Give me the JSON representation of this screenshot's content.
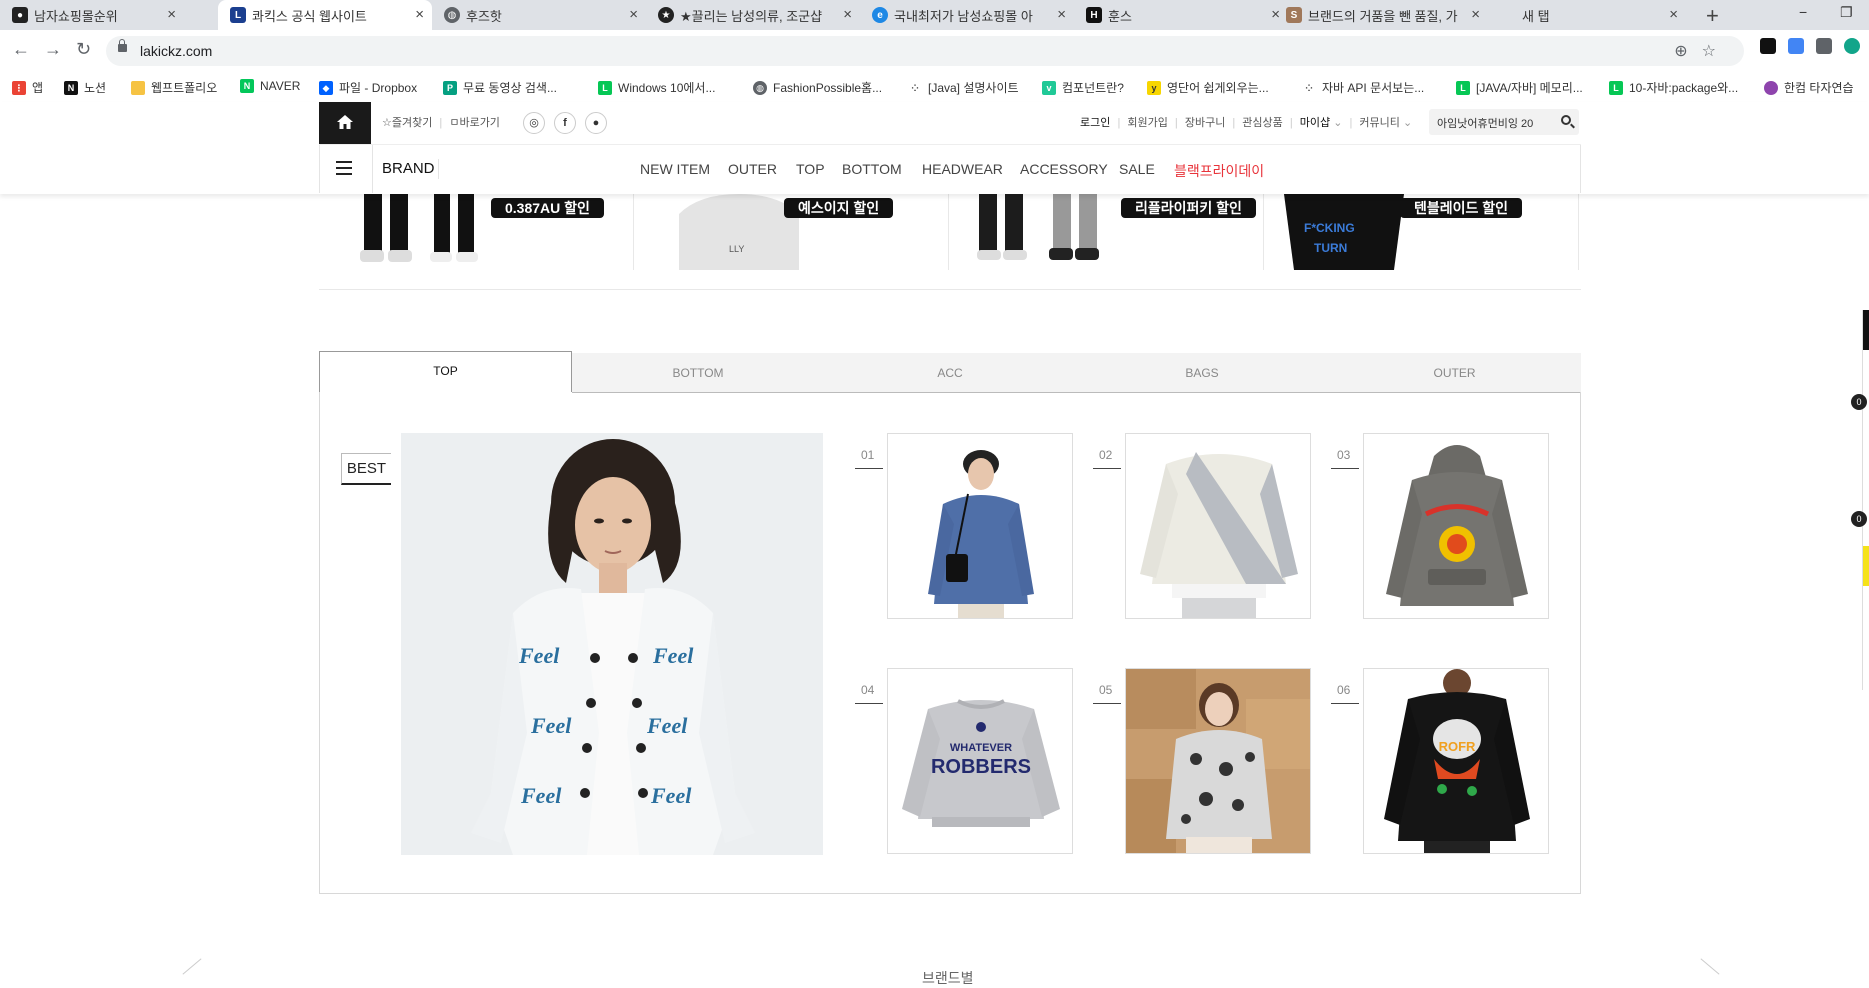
{
  "browser": {
    "tabs": [
      {
        "title": "남자쇼핑몰순위",
        "active": false
      },
      {
        "title": "콰킥스 공식 웹사이트",
        "active": true
      },
      {
        "title": "후즈핫",
        "active": false
      },
      {
        "title": "★끌리는 남성의류, 조군샵",
        "active": false
      },
      {
        "title": "국내최저가 남성쇼핑몰 아",
        "active": false
      },
      {
        "title": "훈스",
        "active": false
      },
      {
        "title": "브랜드의 거품을 뺀 품질, 가",
        "active": false
      },
      {
        "title": "새 탭",
        "active": false
      }
    ],
    "new_tab_symbol": "+",
    "url": "lakickz.com",
    "bookmarks": [
      {
        "label": "앱",
        "icon": "apps-grid-icon"
      },
      {
        "label": "노션",
        "icon": "notion-icon"
      },
      {
        "label": "웹프트폴리오",
        "icon": "folder-icon"
      },
      {
        "label": "NAVER",
        "icon": "naver-icon"
      },
      {
        "label": "파일 - Dropbox",
        "icon": "dropbox-icon"
      },
      {
        "label": "무료 동영상 검색...",
        "icon": "pexels-icon"
      },
      {
        "label": "Windows 10에서...",
        "icon": "line-icon"
      },
      {
        "label": "FashionPossible홈...",
        "icon": "globe-icon"
      },
      {
        "label": "[Java] 설명사이트",
        "icon": "dots-icon"
      },
      {
        "label": "컴포넌트란?",
        "icon": "velog-icon"
      },
      {
        "label": "영단어 쉽게외우는...",
        "icon": "yellow-icon"
      },
      {
        "label": "자바 API 문서보는...",
        "icon": "dots-icon"
      },
      {
        "label": "[JAVA/자바] 메모리...",
        "icon": "line-icon"
      },
      {
        "label": "10-자바:package와...",
        "icon": "line-icon"
      },
      {
        "label": "한컴 타자연습",
        "icon": "hancom-icon"
      }
    ]
  },
  "site": {
    "top_links": [
      "☆즐겨찾기",
      "ㅁ바로가기"
    ],
    "sns": [
      "instagram",
      "facebook",
      "chat"
    ],
    "sns_glyphs": [
      "◎",
      "f",
      "●"
    ],
    "user_links": [
      "로그인",
      "회원가입",
      "장바구니",
      "관심상품",
      "마이샵",
      "커뮤니티"
    ],
    "search_value": "아임낫어휴먼비잉 20",
    "brand_label": "BRAND",
    "menu": [
      "NEW ITEM",
      "OUTER",
      "TOP",
      "BOTTOM",
      "HEADWEAR",
      "ACCESSORY",
      "SALE",
      "블랙프라이데이"
    ],
    "menu_highlight_color": "#e8343b",
    "banners": [
      "0.387AU 할인",
      "예스이지 할인",
      "리플라이퍼키 할인",
      "텐블레이드 할인"
    ],
    "category_tabs": [
      "TOP",
      "BOTTOM",
      "ACC",
      "BAGS",
      "OUTER"
    ],
    "active_tab": "TOP",
    "best_label": "BEST",
    "products": [
      {
        "rank": "01",
        "desc": "blue knit with crossbody bag"
      },
      {
        "rank": "02",
        "desc": "grey diagonal sweatshirt"
      },
      {
        "rank": "03",
        "desc": "charcoal graphic hoodie"
      },
      {
        "rank": "04",
        "desc": "grey robbers sweatshirt"
      },
      {
        "rank": "05",
        "desc": "paisley print hoodie"
      },
      {
        "rank": "06",
        "desc": "black graphic sweatshirt"
      }
    ],
    "robbers_text": [
      "WHATEVER",
      "ROBBERS"
    ],
    "cardigan_text": "Feel",
    "section_footer": "브랜드별",
    "quick_badges": [
      "0",
      "0"
    ]
  }
}
